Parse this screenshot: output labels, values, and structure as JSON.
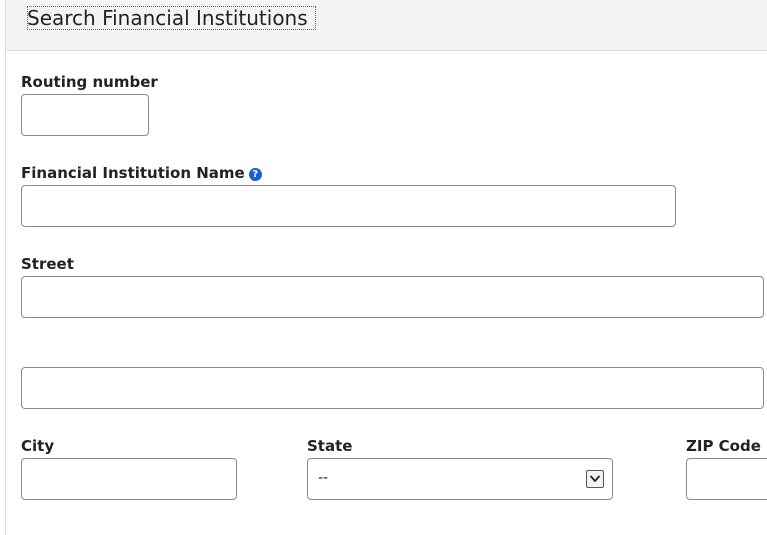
{
  "header": {
    "title": "Search Financial Institutions"
  },
  "form": {
    "routing": {
      "label": "Routing number",
      "value": ""
    },
    "institution_name": {
      "label": "Financial Institution Name",
      "value": "",
      "help_icon": "question-circle-icon"
    },
    "street": {
      "label": "Street",
      "value_line1": "",
      "value_line2": ""
    },
    "city": {
      "label": "City",
      "value": ""
    },
    "state": {
      "label": "State",
      "selected": "--",
      "dropdown_icon": "chevron-down-icon"
    },
    "zip": {
      "label": "ZIP Code",
      "value": ""
    }
  },
  "colors": {
    "header_bg": "#f4f4f4",
    "help_icon": "#1c5fd1",
    "input_border": "#8a8a8a"
  }
}
